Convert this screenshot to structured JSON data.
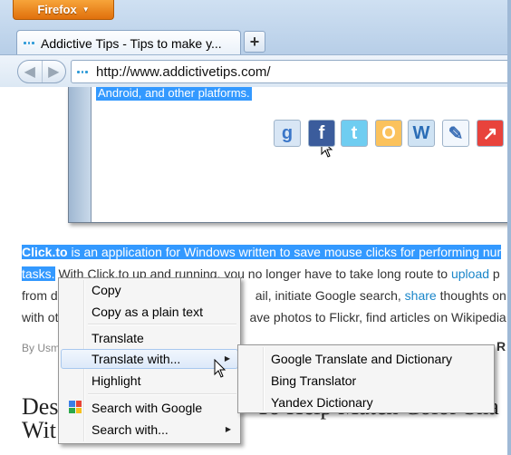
{
  "browser": {
    "app_button": "Firefox",
    "tab_title": "Addictive Tips - Tips to make y...",
    "new_tab_label": "+",
    "url": "http://www.addictivetips.com/"
  },
  "page": {
    "inner_selected_text": "Android, and other platforms.",
    "share_buttons": [
      {
        "label": "g",
        "icon": "google-bookmark-icon",
        "color": "#d8e6f5",
        "text_color": "#3a76c8"
      },
      {
        "label": "f",
        "icon": "facebook-icon",
        "color": "#3b5c9c",
        "text_color": "#ffffff"
      },
      {
        "label": "t",
        "icon": "twitter-icon",
        "color": "#6fcdf1",
        "text_color": "#ffffff"
      },
      {
        "label": "O",
        "icon": "orkut-icon",
        "color": "#fbc25c",
        "text_color": "#ffffff"
      },
      {
        "label": "W",
        "icon": "wordpress-icon",
        "color": "#cfe3f4",
        "text_color": "#2a6db6"
      },
      {
        "label": "✎",
        "icon": "notepad-icon",
        "color": "#f2f7fd",
        "text_color": "#3b6fb6"
      },
      {
        "label": "↗",
        "icon": "share-arrow-icon",
        "color": "#e8433c",
        "text_color": "#ffffff"
      }
    ],
    "para": {
      "l1_sel": "Click.to",
      "l1_sel_rest": " is an application for Windows written to save mouse clicks for performing nur",
      "l2_sel": "tasks.",
      "l2_a": " With Click.to up and running, you no longer have to take long route to ",
      "l2_link": "upload",
      "l2_b": " p",
      "l3_a": "from d",
      "l3_b": "ail, initiate Google search, ",
      "l3_link": "share",
      "l3_c": " thoughts on T",
      "l4_a": "with ot",
      "l4_b": "ave photos to Flickr, find articles on Wikipedia a"
    },
    "author_prefix": "By Usm",
    "right_letter": "R",
    "heading_l1a": "Des",
    "heading_l1b": "To Help Match Color Sha",
    "heading_l2a": "Wit",
    "heading_l2b": "g"
  },
  "context_menu": {
    "items": [
      {
        "label": "Copy"
      },
      {
        "label": "Copy as a plain text"
      },
      {
        "label": "Translate"
      },
      {
        "label": "Translate with...",
        "submenu": true
      },
      {
        "label": "Highlight"
      },
      {
        "label": "Search with Google"
      },
      {
        "label": "Search with...",
        "submenu": true
      }
    ]
  },
  "submenu": {
    "items": [
      {
        "label": "Google Translate and Dictionary"
      },
      {
        "label": "Bing Translator"
      },
      {
        "label": "Yandex Dictionary"
      }
    ]
  }
}
